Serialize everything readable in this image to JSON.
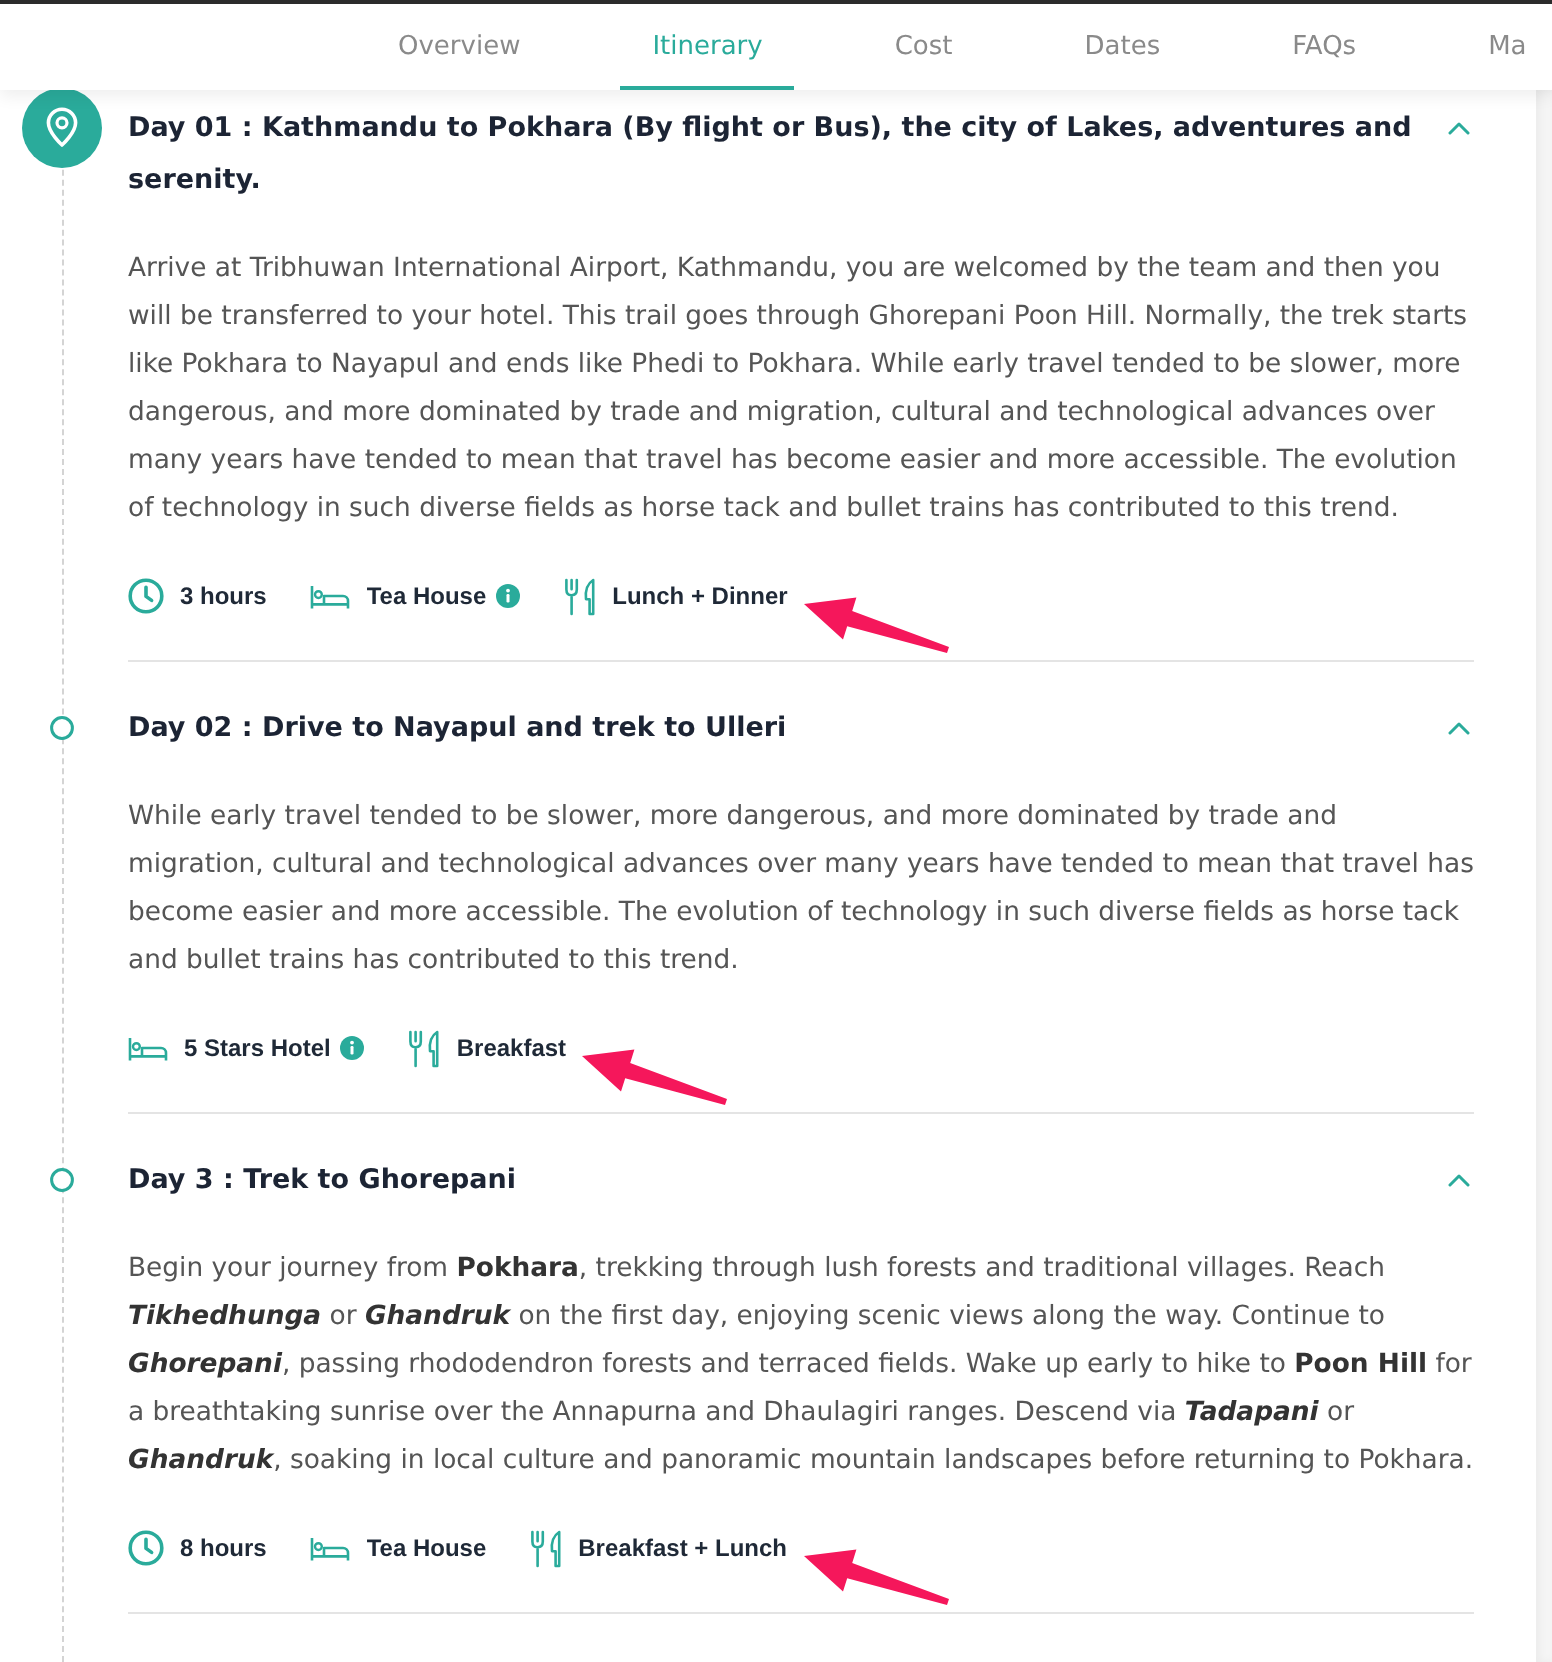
{
  "nav": {
    "tabs": [
      {
        "label": "Overview",
        "selected": false
      },
      {
        "label": "Itinerary",
        "selected": true
      },
      {
        "label": "Cost",
        "selected": false
      },
      {
        "label": "Dates",
        "selected": false
      },
      {
        "label": "FAQs",
        "selected": false
      },
      {
        "label": "Ma",
        "selected": false
      }
    ]
  },
  "itinerary": {
    "days": [
      {
        "title": "Day 01 : Kathmandu to Pokhara (By flight or Bus), the city of Lakes, adventures and serenity.",
        "active": true,
        "expanded": true,
        "description": "Arrive at Tribhuwan International Airport, Kathmandu, you are welcomed by the team and then you will be transferred to your hotel. This trail goes through Ghorepani Poon Hill. Normally, the trek starts like Pokhara to Nayapul and ends like Phedi to Pokhara. While early travel tended to be slower, more dangerous, and more dominated by trade and migration, cultural and technological advances over many years have tended to mean that travel has become easier and more accessible. The evolution of technology in such diverse fields as horse tack and bullet trains has contributed to this trend.",
        "details": [
          {
            "kind": "duration",
            "text": "3 hours",
            "info": false,
            "annotated": false
          },
          {
            "kind": "lodging",
            "text": "Tea House",
            "info": true,
            "annotated": false
          },
          {
            "kind": "meals",
            "text": "Lunch + Dinner",
            "info": false,
            "annotated": true
          }
        ]
      },
      {
        "title": "Day 02 : Drive to Nayapul and trek to Ulleri",
        "active": false,
        "expanded": true,
        "description": "While early travel tended to be slower, more dangerous, and more dominated by trade and migration, cultural and technological advances over many years have tended to mean that travel has become easier and more accessible. The evolution of technology in such diverse fields as horse tack and bullet trains has contributed to this trend.",
        "details": [
          {
            "kind": "lodging",
            "text": "5 Stars Hotel",
            "info": true,
            "annotated": false
          },
          {
            "kind": "meals",
            "text": "Breakfast",
            "info": false,
            "annotated": true
          }
        ]
      },
      {
        "title": "Day 3 : Trek to Ghorepani",
        "active": false,
        "expanded": true,
        "description": "Begin your journey from **Pokhara**, trekking through lush forests and traditional villages. Reach *Tikhedhunga* or *Ghandruk* on the first day, enjoying scenic views along the way. Continue to *Ghorepani*, passing rhododendron forests and terraced fields. Wake up early to hike to **Poon Hill** for a breathtaking sunrise over the Annapurna and Dhaulagiri ranges. Descend via *Tadapani* or *Ghandruk*, soaking in local culture and panoramic mountain landscapes before returning to Pokhara.",
        "details": [
          {
            "kind": "duration",
            "text": "8 hours",
            "info": false,
            "annotated": false
          },
          {
            "kind": "lodging",
            "text": "Tea House",
            "info": false,
            "annotated": false
          },
          {
            "kind": "meals",
            "text": "Breakfast + Lunch",
            "info": false,
            "annotated": true
          }
        ]
      }
    ]
  }
}
